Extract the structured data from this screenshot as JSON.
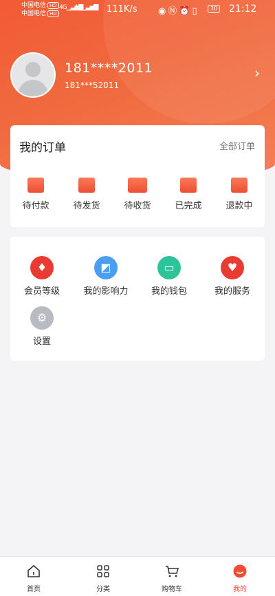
{
  "status_bar": {
    "carrier1": "中国电信",
    "carrier2": "中国电信",
    "hd": "HD",
    "net": "4G",
    "speed": "111K/s",
    "battery": "30",
    "time": "21:12"
  },
  "profile": {
    "name": "181****2011",
    "id": "181***52011"
  },
  "orders": {
    "title": "我的订单",
    "all_label": "全部订单",
    "items": [
      {
        "label": "待付款",
        "icon": "wallet-icon"
      },
      {
        "label": "待发货",
        "icon": "package-icon"
      },
      {
        "label": "待收货",
        "icon": "truck-icon"
      },
      {
        "label": "已完成",
        "icon": "message-done-icon"
      },
      {
        "label": "退款中",
        "icon": "message-refund-icon"
      }
    ]
  },
  "services": {
    "items": [
      {
        "label": "会员等级",
        "icon": "diamond-icon",
        "color": "#ea3b33"
      },
      {
        "label": "我的影响力",
        "icon": "chart-icon",
        "color": "#4a9ff0"
      },
      {
        "label": "我的钱包",
        "icon": "wallet-icon",
        "color": "#2fc39a"
      },
      {
        "label": "我的服务",
        "icon": "handshake-icon",
        "color": "#ea3b33"
      },
      {
        "label": "设置",
        "icon": "gear-icon",
        "color": "#b9bbc3"
      }
    ]
  },
  "bottom_nav": {
    "items": [
      {
        "label": "首页",
        "icon": "home-icon"
      },
      {
        "label": "分类",
        "icon": "category-icon"
      },
      {
        "label": "购物车",
        "icon": "cart-icon"
      },
      {
        "label": "我的",
        "icon": "profile-icon"
      }
    ],
    "active_index": 3
  },
  "colors": {
    "accent": "#ee4e33",
    "header_start": "#f25a35",
    "header_end": "#f58055"
  }
}
